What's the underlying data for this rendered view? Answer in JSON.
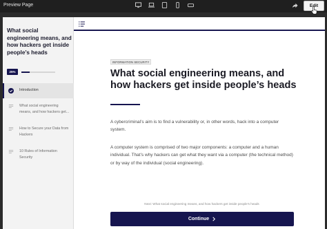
{
  "topbar": {
    "title": "Preview Page",
    "devices": [
      "desktop-icon",
      "laptop-icon",
      "tablet-landscape-icon",
      "phone-portrait-icon",
      "phone-landscape-icon"
    ],
    "edit_label": "Edit"
  },
  "sidebar": {
    "title": "What social engineering means, and how hackers get inside people’s heads",
    "progress_label": "25%",
    "progress_fraction": 0.25,
    "lessons": [
      {
        "label": "Introduction",
        "state": "active"
      },
      {
        "label": "What social engineering means, and how hackers get...",
        "state": "default"
      },
      {
        "label": "How to Secure your Data from Hackers",
        "state": "default"
      },
      {
        "label": "10 Rules of Information Security",
        "state": "default"
      }
    ]
  },
  "main": {
    "tag": "INFORMATION SECURITY",
    "heading": "What social engineering means, and how hackers get inside people’s heads",
    "paragraphs": [
      "A cybercriminal’s aim is to find a vulnerability or, in other words, hack into a computer system.",
      "A computer system is comprised of two major components: a computer and a human individual. That’s why hackers can get what they want via a computer (the technical method) or by way of the individual (social engineering)."
    ],
    "next_label": "Next: What social engineering means, and how hackers get inside people’s heads",
    "continue_label": "Continue"
  },
  "colors": {
    "accent": "#16154f",
    "topbar": "#1f1f1f",
    "sidebar_bg": "#f3f3f3"
  }
}
